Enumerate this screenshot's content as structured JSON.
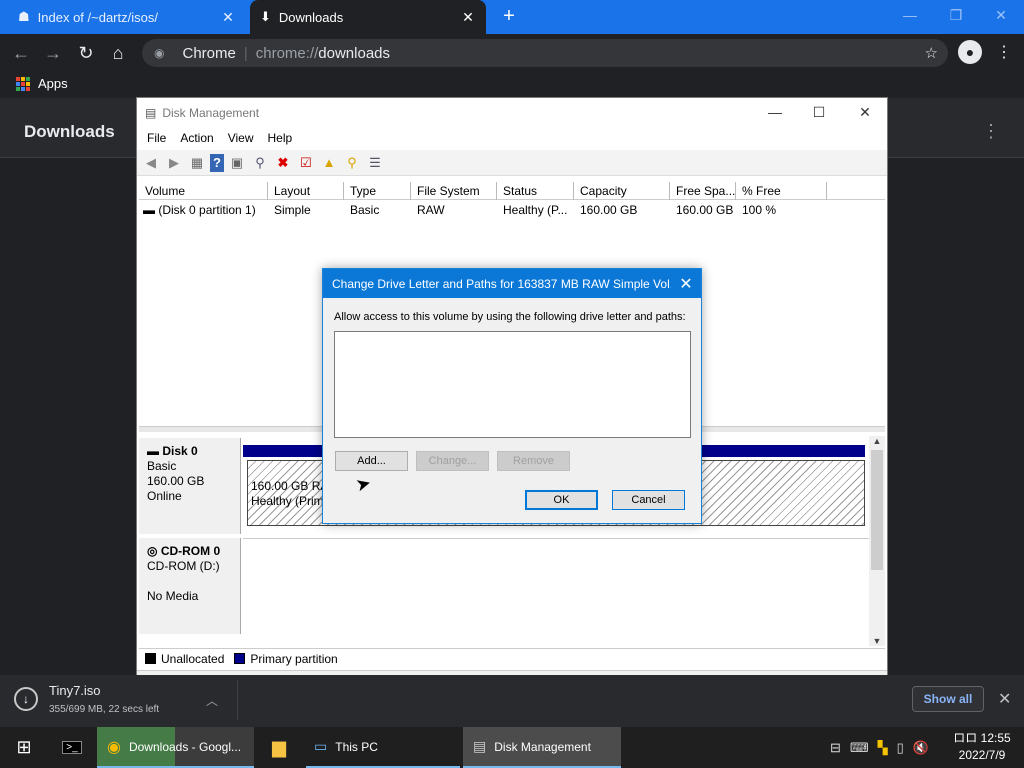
{
  "browser": {
    "tabs": [
      {
        "title": "Index of /~dartz/isos/",
        "icon": "page-icon"
      },
      {
        "title": "Downloads",
        "icon": "download-icon"
      }
    ],
    "new_tab": "+",
    "omnibox": {
      "site": "Chrome",
      "url_scheme": "chrome://",
      "url_host": "downloads"
    },
    "bookmarks": {
      "apps_label": "Apps"
    },
    "page_title": "Downloads"
  },
  "disk_management": {
    "title": "Disk Management",
    "menu": [
      "File",
      "Action",
      "View",
      "Help"
    ],
    "columns": [
      "Volume",
      "Layout",
      "Type",
      "File System",
      "Status",
      "Capacity",
      "Free Spa...",
      "% Free"
    ],
    "rows": [
      {
        "volume": "(Disk 0 partition 1)",
        "layout": "Simple",
        "type": "Basic",
        "fs": "RAW",
        "status": "Healthy (P...",
        "capacity": "160.00 GB",
        "free": "160.00 GB",
        "pct": "100 %"
      }
    ],
    "disk0": {
      "name": "Disk 0",
      "type": "Basic",
      "size": "160.00 GB",
      "state": "Online",
      "partition_size": "160.00 GB RAW",
      "partition_status": "Healthy (Prim"
    },
    "cdrom": {
      "name": "CD-ROM 0",
      "type": "CD-ROM (D:)",
      "media": "No Media"
    },
    "legend": {
      "unallocated": "Unallocated",
      "primary": "Primary partition"
    }
  },
  "dialog": {
    "title": "Change Drive Letter and Paths for 163837 MB RAW Simple Vol...",
    "message": "Allow access to this volume by using the following drive letter and paths:",
    "buttons": {
      "add": "Add...",
      "change": "Change...",
      "remove": "Remove",
      "ok": "OK",
      "cancel": "Cancel"
    }
  },
  "download_shelf": {
    "filename": "Tiny7.iso",
    "progress": "355/699 MB, 22 secs left",
    "show_all": "Show all"
  },
  "taskbar": {
    "chrome": "Downloads - Googl...",
    "this_pc": "This PC",
    "disk_mgmt": "Disk Management",
    "time": "12:55",
    "time_prefix": "ロロ",
    "date": "2022/7/9"
  }
}
